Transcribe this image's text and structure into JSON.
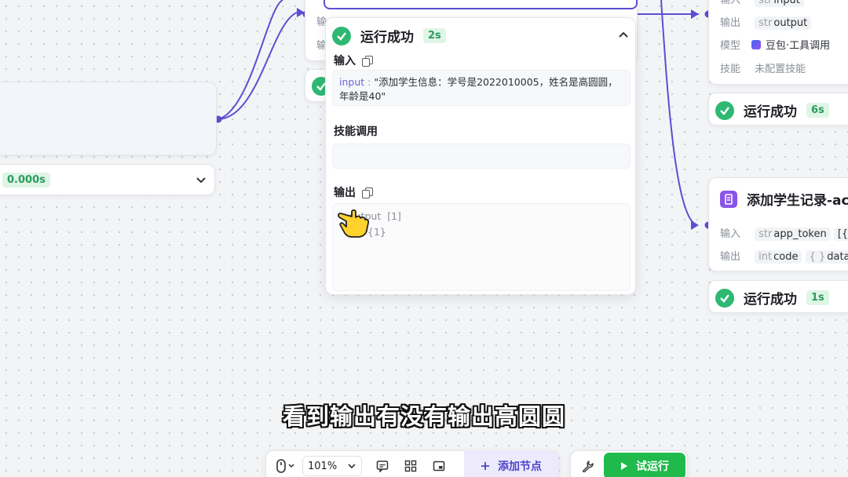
{
  "left_panel": {
    "duration_badge": "0.000s"
  },
  "top_node": {
    "label_partial_1": "输",
    "label_partial_2": "输"
  },
  "result_panel": {
    "status": "运行成功",
    "duration": "2s",
    "input_section": {
      "title": "输入",
      "key": "input",
      "value": "\"添加学生信息：学号是2022010005，姓名是高圆圆，年龄是40\""
    },
    "skill_section": {
      "title": "技能调用"
    },
    "output_section": {
      "title": "输出",
      "key": "output",
      "key_type": "[1]",
      "second_line": "{1}"
    }
  },
  "llm_node": {
    "input_label": "输入",
    "input_chip_type": "str",
    "input_chip_name": "input",
    "output_label": "输出",
    "output_chip_type": "str",
    "output_chip_name": "output",
    "model_label": "模型",
    "model_value": "豆包·工具调用",
    "skill_label": "技能",
    "skill_value": "未配置技能",
    "status": "运行成功",
    "duration": "6s"
  },
  "record_node": {
    "title": "添加学生记录-ac",
    "input_label": "输入",
    "input_chip_type": "str",
    "input_chip_name": "app_token",
    "input_chip2": "[{}] re",
    "output_label": "输出",
    "output_chip_type": "int",
    "output_chip_name": "code",
    "output_chip2_type": "{ }",
    "output_chip2_name": "data",
    "status": "运行成功",
    "duration": "1s"
  },
  "toolbar": {
    "zoom": "101%",
    "add_node": "添加节点",
    "test_run": "试运行"
  },
  "subtitle": "看到输出有没有输出高圆圆",
  "colors": {
    "edge": "#5b4fd1",
    "success": "#2eb872",
    "primary_button": "#1fba4b",
    "add_button_bg": "#eceafc",
    "add_button_text": "#4d43c9"
  }
}
